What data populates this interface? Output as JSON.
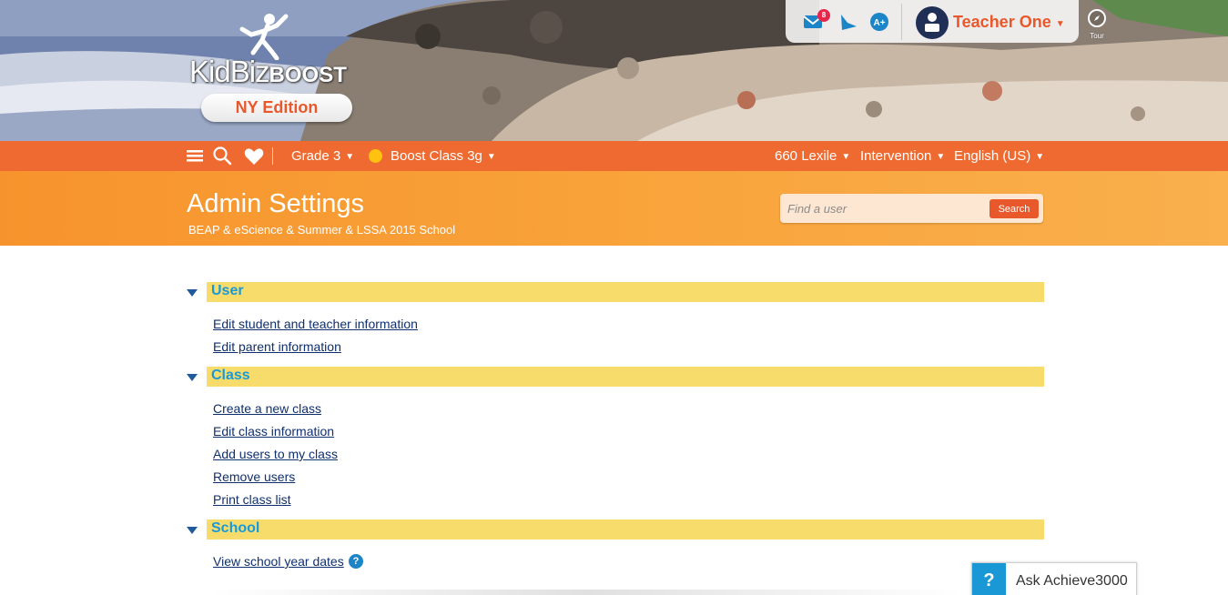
{
  "brand": {
    "logo_text": "KidBiz",
    "logo_bold": "BOOST",
    "edition": "NY Edition"
  },
  "user_panel": {
    "mail_badge": "8",
    "user_name": "Teacher One",
    "tour_label": "Tour"
  },
  "nav": {
    "grade": "Grade 3",
    "class_name": "Boost Class 3g",
    "lexile": "660 Lexile",
    "mode": "Intervention",
    "language": "English (US)"
  },
  "page": {
    "title": "Admin Settings",
    "subtitle": "BEAP & eScience & Summer & LSSA 2015 School"
  },
  "search": {
    "placeholder": "Find a user",
    "button_label": "Search"
  },
  "sections": [
    {
      "title": "User",
      "links": [
        "Edit student and teacher information",
        "Edit parent information"
      ]
    },
    {
      "title": "Class",
      "links": [
        "Create a new class",
        "Edit class information",
        "Add users to my class",
        "Remove users",
        "Print class list"
      ]
    },
    {
      "title": "School",
      "links": [
        "View school year dates"
      ]
    }
  ],
  "help": {
    "help_glyph": "?",
    "ask_glyph": "?",
    "ask_label": "Ask Achieve3000"
  },
  "colors": {
    "nav_orange": "#ee6a30",
    "header_orange": "#f9a43c",
    "section_yellow": "#f8dc6b",
    "section_title_blue": "#199ad8",
    "link_navy": "#0f2f6e",
    "accent_red_orange": "#e8582b"
  },
  "icons": [
    "mail-icon",
    "announcement-icon",
    "grades-icon",
    "avatar-icon",
    "compass-icon",
    "menu-icon",
    "search-icon",
    "heart-icon",
    "caret-down-icon",
    "help-icon"
  ]
}
